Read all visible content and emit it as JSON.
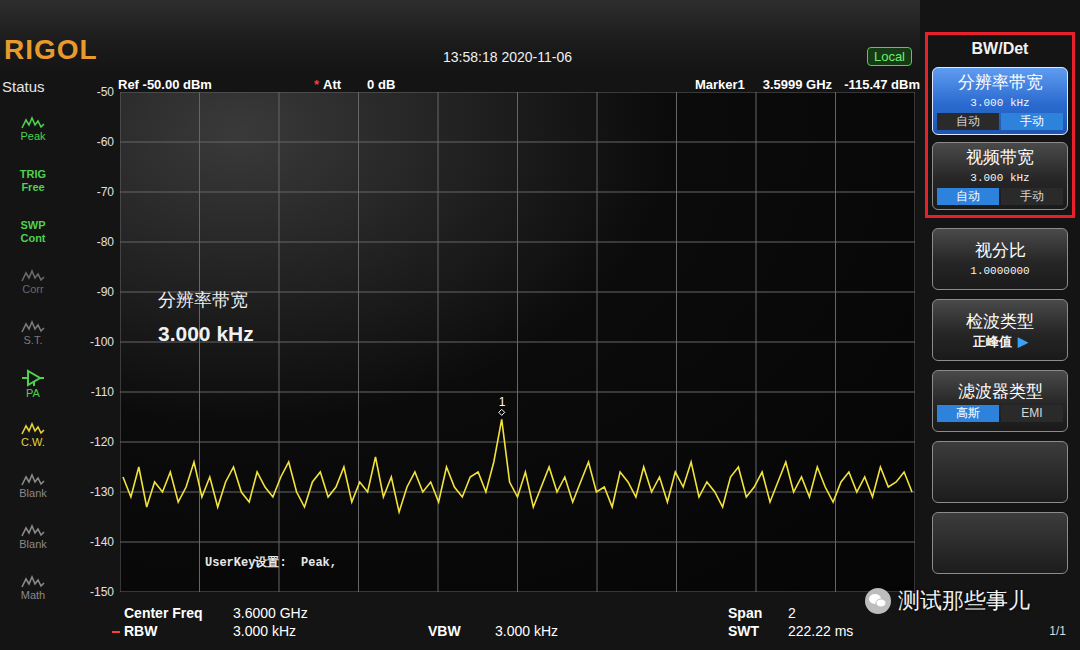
{
  "header": {
    "logo": "RIGOL",
    "clock": "13:58:18 2020-11-06",
    "remote": "Local"
  },
  "status": {
    "title": "Status",
    "items": [
      {
        "kind": "wave",
        "lines": [
          "Peak"
        ],
        "color": "#4ed14e"
      },
      {
        "kind": "text",
        "lines": [
          "TRIG",
          "Free"
        ],
        "color": "#4ed14e"
      },
      {
        "kind": "text",
        "lines": [
          "SWP",
          "Cont"
        ],
        "color": "#4ed14e"
      },
      {
        "kind": "wave",
        "lines": [
          "Corr"
        ],
        "color": "#6a6a6a"
      },
      {
        "kind": "wave",
        "lines": [
          "S.T."
        ],
        "color": "#7a7a7a"
      },
      {
        "kind": "amp",
        "lines": [
          "PA"
        ],
        "color": "#4ed14e"
      },
      {
        "kind": "wave",
        "lines": [
          "C.W."
        ],
        "color": "#e8d23a"
      },
      {
        "kind": "wave",
        "lines": [
          "Blank"
        ],
        "color": "#8a8a8a"
      },
      {
        "kind": "wave",
        "lines": [
          "Blank"
        ],
        "color": "#8a8a8a"
      },
      {
        "kind": "wave",
        "lines": [
          "Math"
        ],
        "color": "#8a8a8a"
      }
    ]
  },
  "chart": {
    "ref": "Ref -50.00 dBm",
    "att": {
      "flag": "*",
      "label": "Att",
      "value": "0 dB"
    },
    "marker": {
      "name": "Marker1",
      "freq": "3.5999 GHz",
      "level": "-115.47 dBm",
      "label": "1"
    },
    "y_ticks": [
      "-50",
      "-60",
      "-70",
      "-80",
      "-90",
      "-100",
      "-110",
      "-120",
      "-130",
      "-140",
      "-150"
    ],
    "trace": [
      -127,
      -131,
      -125,
      -133,
      -128,
      -130,
      -126,
      -132,
      -129,
      -124,
      -131,
      -127,
      -133,
      -128,
      -125,
      -130,
      -132,
      -126,
      -129,
      -131,
      -127,
      -124,
      -130,
      -133,
      -128,
      -126,
      -131,
      -129,
      -125,
      -132,
      -128,
      -130,
      -123,
      -131,
      -127,
      -134,
      -129,
      -126,
      -130,
      -128,
      -132,
      -125,
      -129,
      -131,
      -127,
      -126,
      -130,
      -124,
      -115.47,
      -128,
      -131,
      -126,
      -133,
      -129,
      -125,
      -130,
      -127,
      -132,
      -128,
      -124,
      -130,
      -129,
      -133,
      -126,
      -128,
      -131,
      -125,
      -130,
      -127,
      -132,
      -126,
      -129,
      -124,
      -131,
      -128,
      -130,
      -133,
      -127,
      -125,
      -131,
      -129,
      -126,
      -132,
      -128,
      -124,
      -130,
      -127,
      -131,
      -125,
      -129,
      -132,
      -128,
      -126,
      -130,
      -127,
      -131,
      -125,
      -129,
      -128,
      -126,
      -130
    ],
    "overlay": {
      "title": "分辨率带宽",
      "value": "3.000 kHz"
    },
    "userkey": "UserKey设置:  Peak,"
  },
  "settings": {
    "left": [
      {
        "label": "Center Freq",
        "value": "3.6000 GHz",
        "manual": false
      },
      {
        "label": "RBW",
        "value": "3.000 kHz",
        "manual": true
      }
    ],
    "middle": [
      {
        "label": "VBW",
        "value": "3.000 kHz",
        "manual": false
      }
    ],
    "right": [
      {
        "label": "Span",
        "value": "2",
        "manual": false
      },
      {
        "label": "SWT",
        "value": "222.22 ms",
        "manual": false
      }
    ]
  },
  "menu": {
    "title": "BW/Det",
    "items": [
      {
        "kind": "toggle",
        "label": "分辨率带宽",
        "value": "3.000 kHz",
        "selected": true,
        "highlighted": true,
        "options": [
          {
            "label": "自动",
            "selected": false
          },
          {
            "label": "手动",
            "selected": true
          }
        ]
      },
      {
        "kind": "toggle",
        "label": "视频带宽",
        "value": "3.000 kHz",
        "selected": false,
        "highlighted": true,
        "options": [
          {
            "label": "自动",
            "selected": true
          },
          {
            "label": "手动",
            "selected": false
          }
        ]
      },
      {
        "kind": "value",
        "label": "视分比",
        "value": "1.0000000",
        "selected": false,
        "highlighted": false
      },
      {
        "kind": "submenu",
        "label": "检波类型",
        "value": "正峰值",
        "arrow": "▶",
        "selected": false,
        "highlighted": false
      },
      {
        "kind": "choice",
        "label": "滤波器类型",
        "selected": false,
        "highlighted": false,
        "options": [
          {
            "label": "高斯",
            "selected": true
          },
          {
            "label": "EMI",
            "selected": false
          }
        ]
      },
      {
        "kind": "empty",
        "selected": false,
        "highlighted": false
      },
      {
        "kind": "empty",
        "selected": false,
        "highlighted": false
      }
    ]
  },
  "page": "1/1",
  "watermark": "测试那些事儿"
}
